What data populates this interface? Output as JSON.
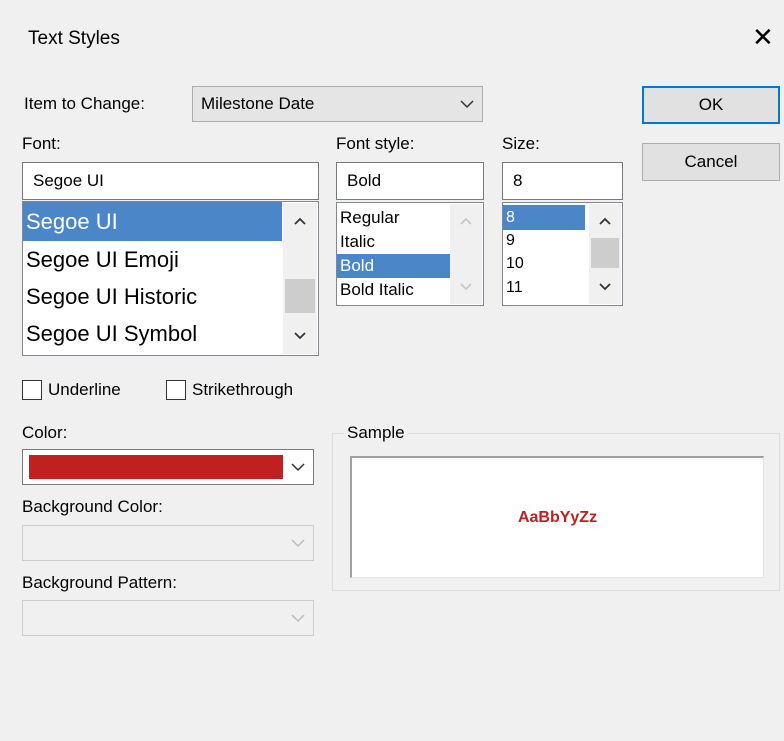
{
  "dialog": {
    "title": "Text Styles"
  },
  "item_to_change": {
    "label": "Item to Change:",
    "value": "Milestone Date"
  },
  "font": {
    "label": "Font:",
    "value": "Segoe UI",
    "items": [
      "Segoe UI",
      "Segoe UI Emoji",
      "Segoe UI Historic",
      "Segoe UI Symbol"
    ],
    "selected_index": 0
  },
  "font_style": {
    "label": "Font style:",
    "value": "Bold",
    "items": [
      "Regular",
      "Italic",
      "Bold",
      "Bold Italic"
    ],
    "selected_index": 2
  },
  "size": {
    "label": "Size:",
    "value": "8",
    "items": [
      "8",
      "9",
      "10",
      "11"
    ],
    "selected_index": 0
  },
  "buttons": {
    "ok": "OK",
    "cancel": "Cancel"
  },
  "checkboxes": {
    "underline": {
      "label": "Underline",
      "checked": false
    },
    "strikethrough": {
      "label": "Strikethrough",
      "checked": false
    }
  },
  "color": {
    "label": "Color:",
    "value_hex": "#c0201f"
  },
  "background_color": {
    "label": "Background Color:"
  },
  "background_pattern": {
    "label": "Background Pattern:"
  },
  "sample": {
    "label": "Sample",
    "text": "AaBbYyZz",
    "color_hex": "#c0201f"
  },
  "icons": {
    "close": "close-icon",
    "dropdown": "chevron-down-icon",
    "scroll_up": "scroll-up-arrow-icon",
    "scroll_down": "scroll-down-arrow-icon"
  }
}
